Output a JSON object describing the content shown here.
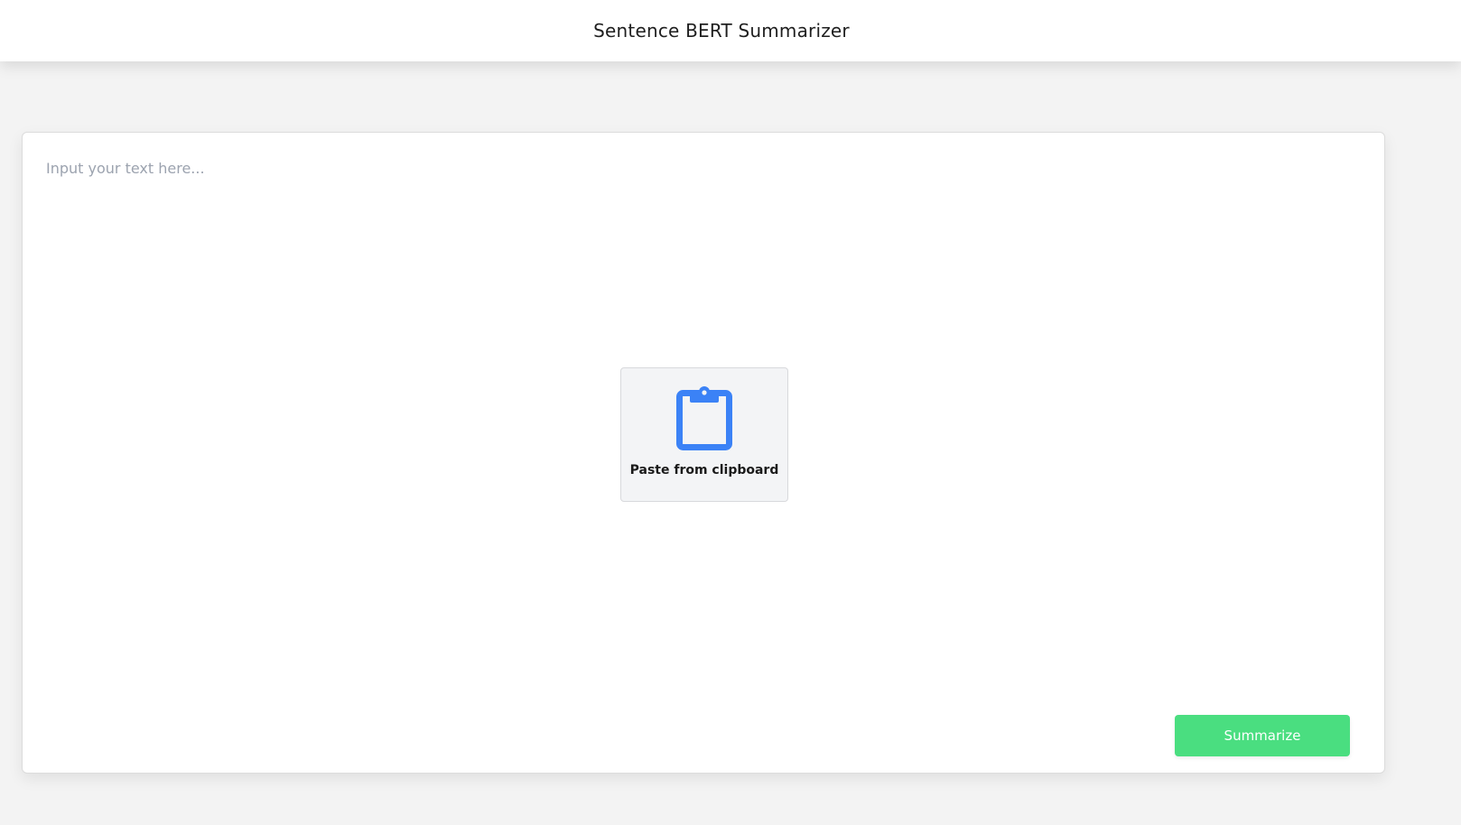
{
  "header": {
    "title": "Sentence BERT Summarizer"
  },
  "editor": {
    "placeholder": "Input your text here...",
    "value": ""
  },
  "paste": {
    "icon": "clipboard-icon",
    "label": "Paste from clipboard"
  },
  "actions": {
    "summarize_label": "Summarize"
  },
  "colors": {
    "accent_green": "#4ade80",
    "icon_blue": "#3b82f6",
    "background": "#f3f3f3"
  }
}
